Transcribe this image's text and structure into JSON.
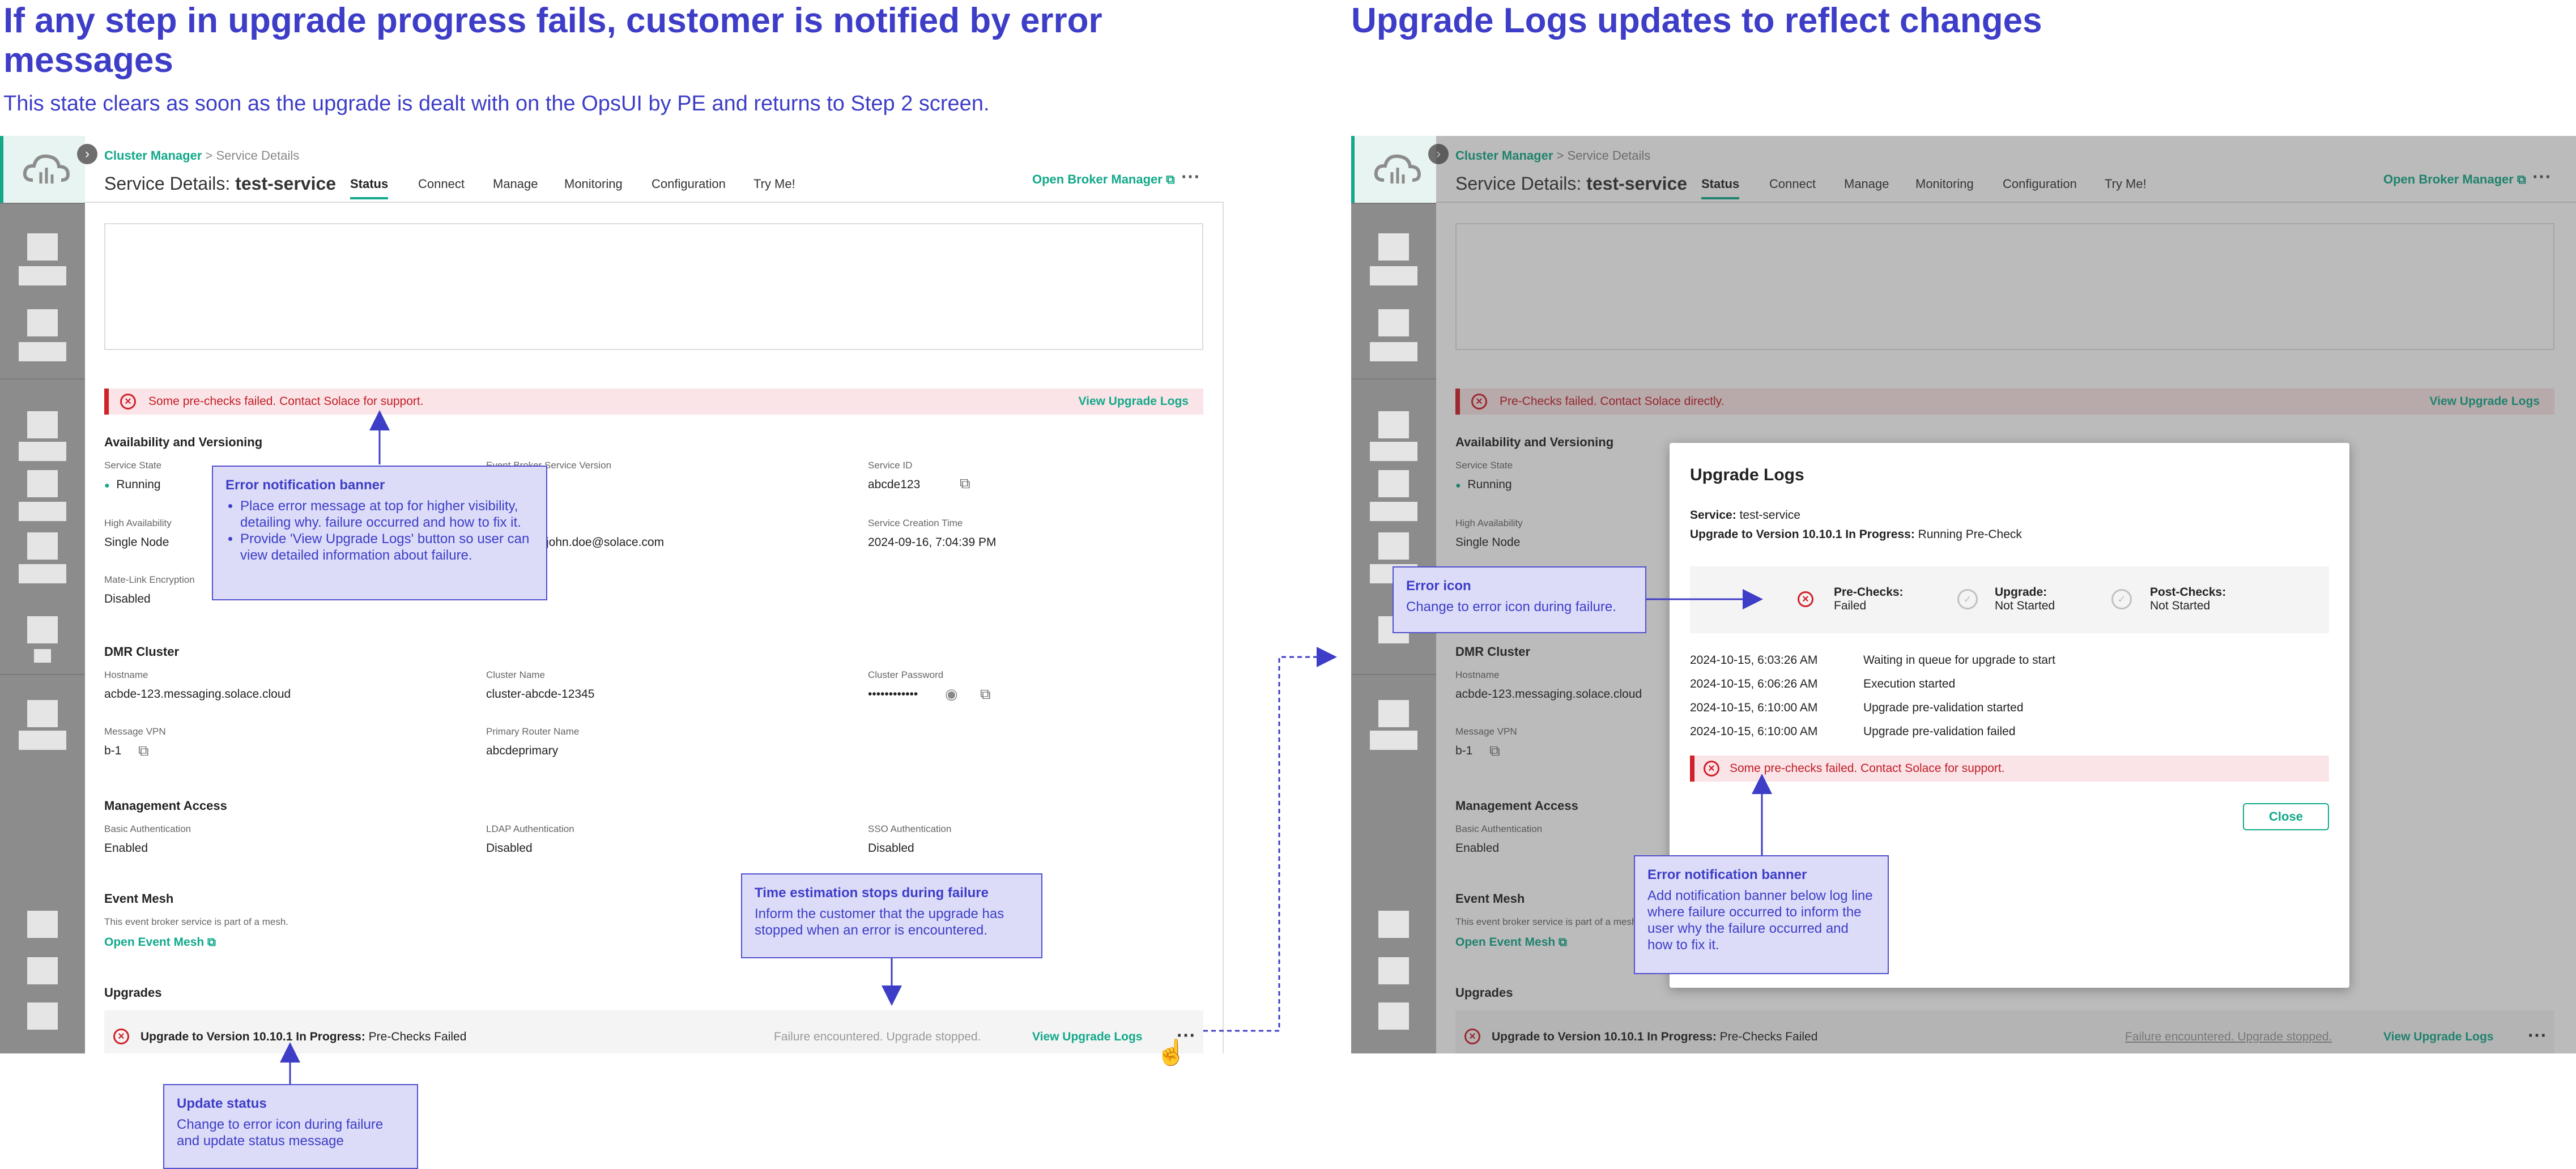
{
  "headings": {
    "left_title": "If any step in upgrade progress fails, customer is notified by error messages",
    "left_subtitle": "This state clears as soon as the upgrade is dealt with on the OpsUI by PE and returns to Step 2 screen.",
    "right_title": "Upgrade Logs updates to reflect changes"
  },
  "app": {
    "breadcrumb_root": "Cluster Manager",
    "breadcrumb_sep": ">",
    "breadcrumb_current": "Service Details",
    "title_prefix": "Service Details:",
    "title_service": "test-service",
    "tabs": [
      "Status",
      "Connect",
      "Manage",
      "Monitoring",
      "Configuration",
      "Try Me!"
    ],
    "open_broker_manager": "Open Broker Manager",
    "more_icon": "more-horizontal-icon",
    "view_upgrade_logs": "View Upgrade Logs",
    "availability": {
      "heading": "Availability and Versioning",
      "service_state_label": "Service State",
      "service_state": "Running",
      "broker_version_label": "Event Broker Service Version",
      "service_id_label": "Service ID",
      "service_id": "abcde123",
      "high_availability_label": "High Availability",
      "high_availability": "Single Node",
      "owner": "john.doe@solace.com",
      "creation_time_label": "Service Creation Time",
      "creation_time": "2024-09-16, 7:04:39 PM",
      "mate_link_label": "Mate-Link Encryption",
      "mate_link": "Disabled"
    },
    "dmr": {
      "heading": "DMR Cluster",
      "hostname_label": "Hostname",
      "hostname": "acbde-123.messaging.solace.cloud",
      "cluster_name_label": "Cluster Name",
      "cluster_name": "cluster-abcde-12345",
      "cluster_password_label": "Cluster Password",
      "cluster_password": "••••••••••••",
      "message_vpn_label": "Message VPN",
      "message_vpn": "b-1",
      "primary_router_label": "Primary Router Name",
      "primary_router": "abcdeprimary"
    },
    "management": {
      "heading": "Management Access",
      "basic_label": "Basic Authentication",
      "basic": "Enabled",
      "ldap_label": "LDAP Authentication",
      "ldap": "Disabled",
      "sso_label": "SSO Authentication",
      "sso": "Disabled"
    },
    "event_mesh": {
      "heading": "Event Mesh",
      "text": "This event broker service is part of a mesh.",
      "link": "Open Event Mesh"
    },
    "upgrades": {
      "heading": "Upgrades",
      "row_bold": "Upgrade to Version 10.10.1 In Progress:",
      "row_status": "Pre-Checks Failed",
      "failure_text": "Failure encountered. Upgrade stopped."
    }
  },
  "left_banner": "Some pre-checks failed. Contact Solace for support.",
  "right_banner": "Pre-Checks failed. Contact Solace directly.",
  "modal": {
    "title": "Upgrade Logs",
    "service_label": "Service:",
    "service": "test-service",
    "upgrade_label": "Upgrade to Version 10.10.1 In Progress:",
    "upgrade_status": "Running Pre-Check",
    "steps": [
      {
        "name": "Pre-Checks:",
        "status": "Failed"
      },
      {
        "name": "Upgrade:",
        "status": "Not Started"
      },
      {
        "name": "Post-Checks:",
        "status": "Not Started"
      }
    ],
    "logs": [
      {
        "time": "2024-10-15, 6:03:26 AM",
        "msg": "Waiting in queue for upgrade to start"
      },
      {
        "time": "2024-10-15, 6:06:26 AM",
        "msg": "Execution started"
      },
      {
        "time": "2024-10-15, 6:10:00 AM",
        "msg": "Upgrade pre-validation started"
      },
      {
        "time": "2024-10-15, 6:10:00 AM",
        "msg": "Upgrade pre-validation failed"
      }
    ],
    "error": "Some pre-checks failed. Contact Solace for support.",
    "close": "Close"
  },
  "callouts": {
    "error_banner_title": "Error notification banner",
    "error_banner_bullets": [
      "Place error message at top for higher visibility, detailing why. failure occurred and how to fix it.",
      "Provide 'View Upgrade Logs' button so user can view detailed information about failure."
    ],
    "time_title": "Time estimation stops during failure",
    "time_body": "Inform the customer that the upgrade has stopped when an error is encountered.",
    "update_title": "Update status",
    "update_body": "Change to error icon during failure and update status message",
    "error_icon_title": "Error icon",
    "error_icon_body": "Change to error icon during failure.",
    "modal_banner_title": "Error notification banner",
    "modal_banner_body": "Add notification banner below log line where failure occurred to inform the user why the failure occurred and how to fix it."
  },
  "colors": {
    "accent": "#12a88a",
    "error": "#d0202a",
    "annotation": "#3d3dc8"
  }
}
